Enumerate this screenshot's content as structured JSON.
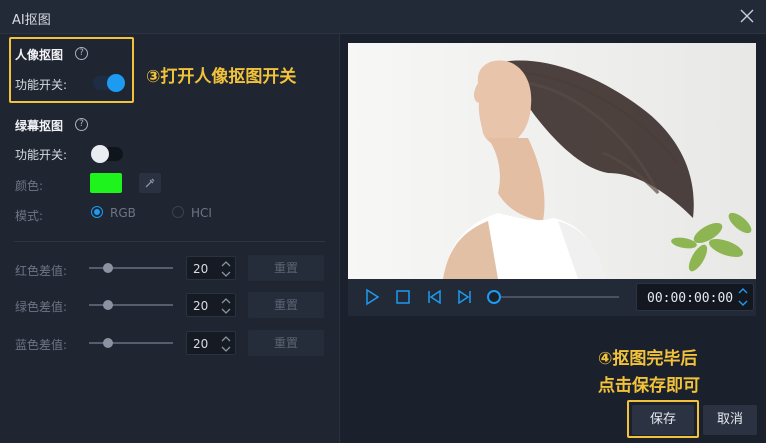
{
  "window": {
    "title": "AI抠图"
  },
  "portrait": {
    "title": "人像抠图",
    "switch_label": "功能开关:",
    "enabled": true
  },
  "green_screen": {
    "title": "绿幕抠图",
    "switch_label": "功能开关:",
    "enabled": false,
    "color_label": "颜色:",
    "color": "#1ef31e",
    "mode_label": "模式:",
    "modes": [
      {
        "label": "RGB",
        "selected": true
      },
      {
        "label": "HCI",
        "selected": false
      }
    ],
    "diffs": [
      {
        "label": "红色差值:",
        "value": "20",
        "level": 0.3,
        "reset_label": "重置"
      },
      {
        "label": "绿色差值:",
        "value": "20",
        "level": 0.3,
        "reset_label": "重置"
      },
      {
        "label": "蓝色差值:",
        "value": "20",
        "level": 0.3,
        "reset_label": "重置"
      }
    ]
  },
  "player": {
    "time": "00:00:00:00",
    "progress": 0
  },
  "annotations": {
    "step3": "③打开人像抠图开关",
    "step4_line1": "④抠图完毕后",
    "step4_line2": "点击保存即可"
  },
  "footer": {
    "save_label": "保存",
    "cancel_label": "取消"
  },
  "colors": {
    "accent": "#1d9bf0",
    "highlight": "#f2c33a"
  }
}
